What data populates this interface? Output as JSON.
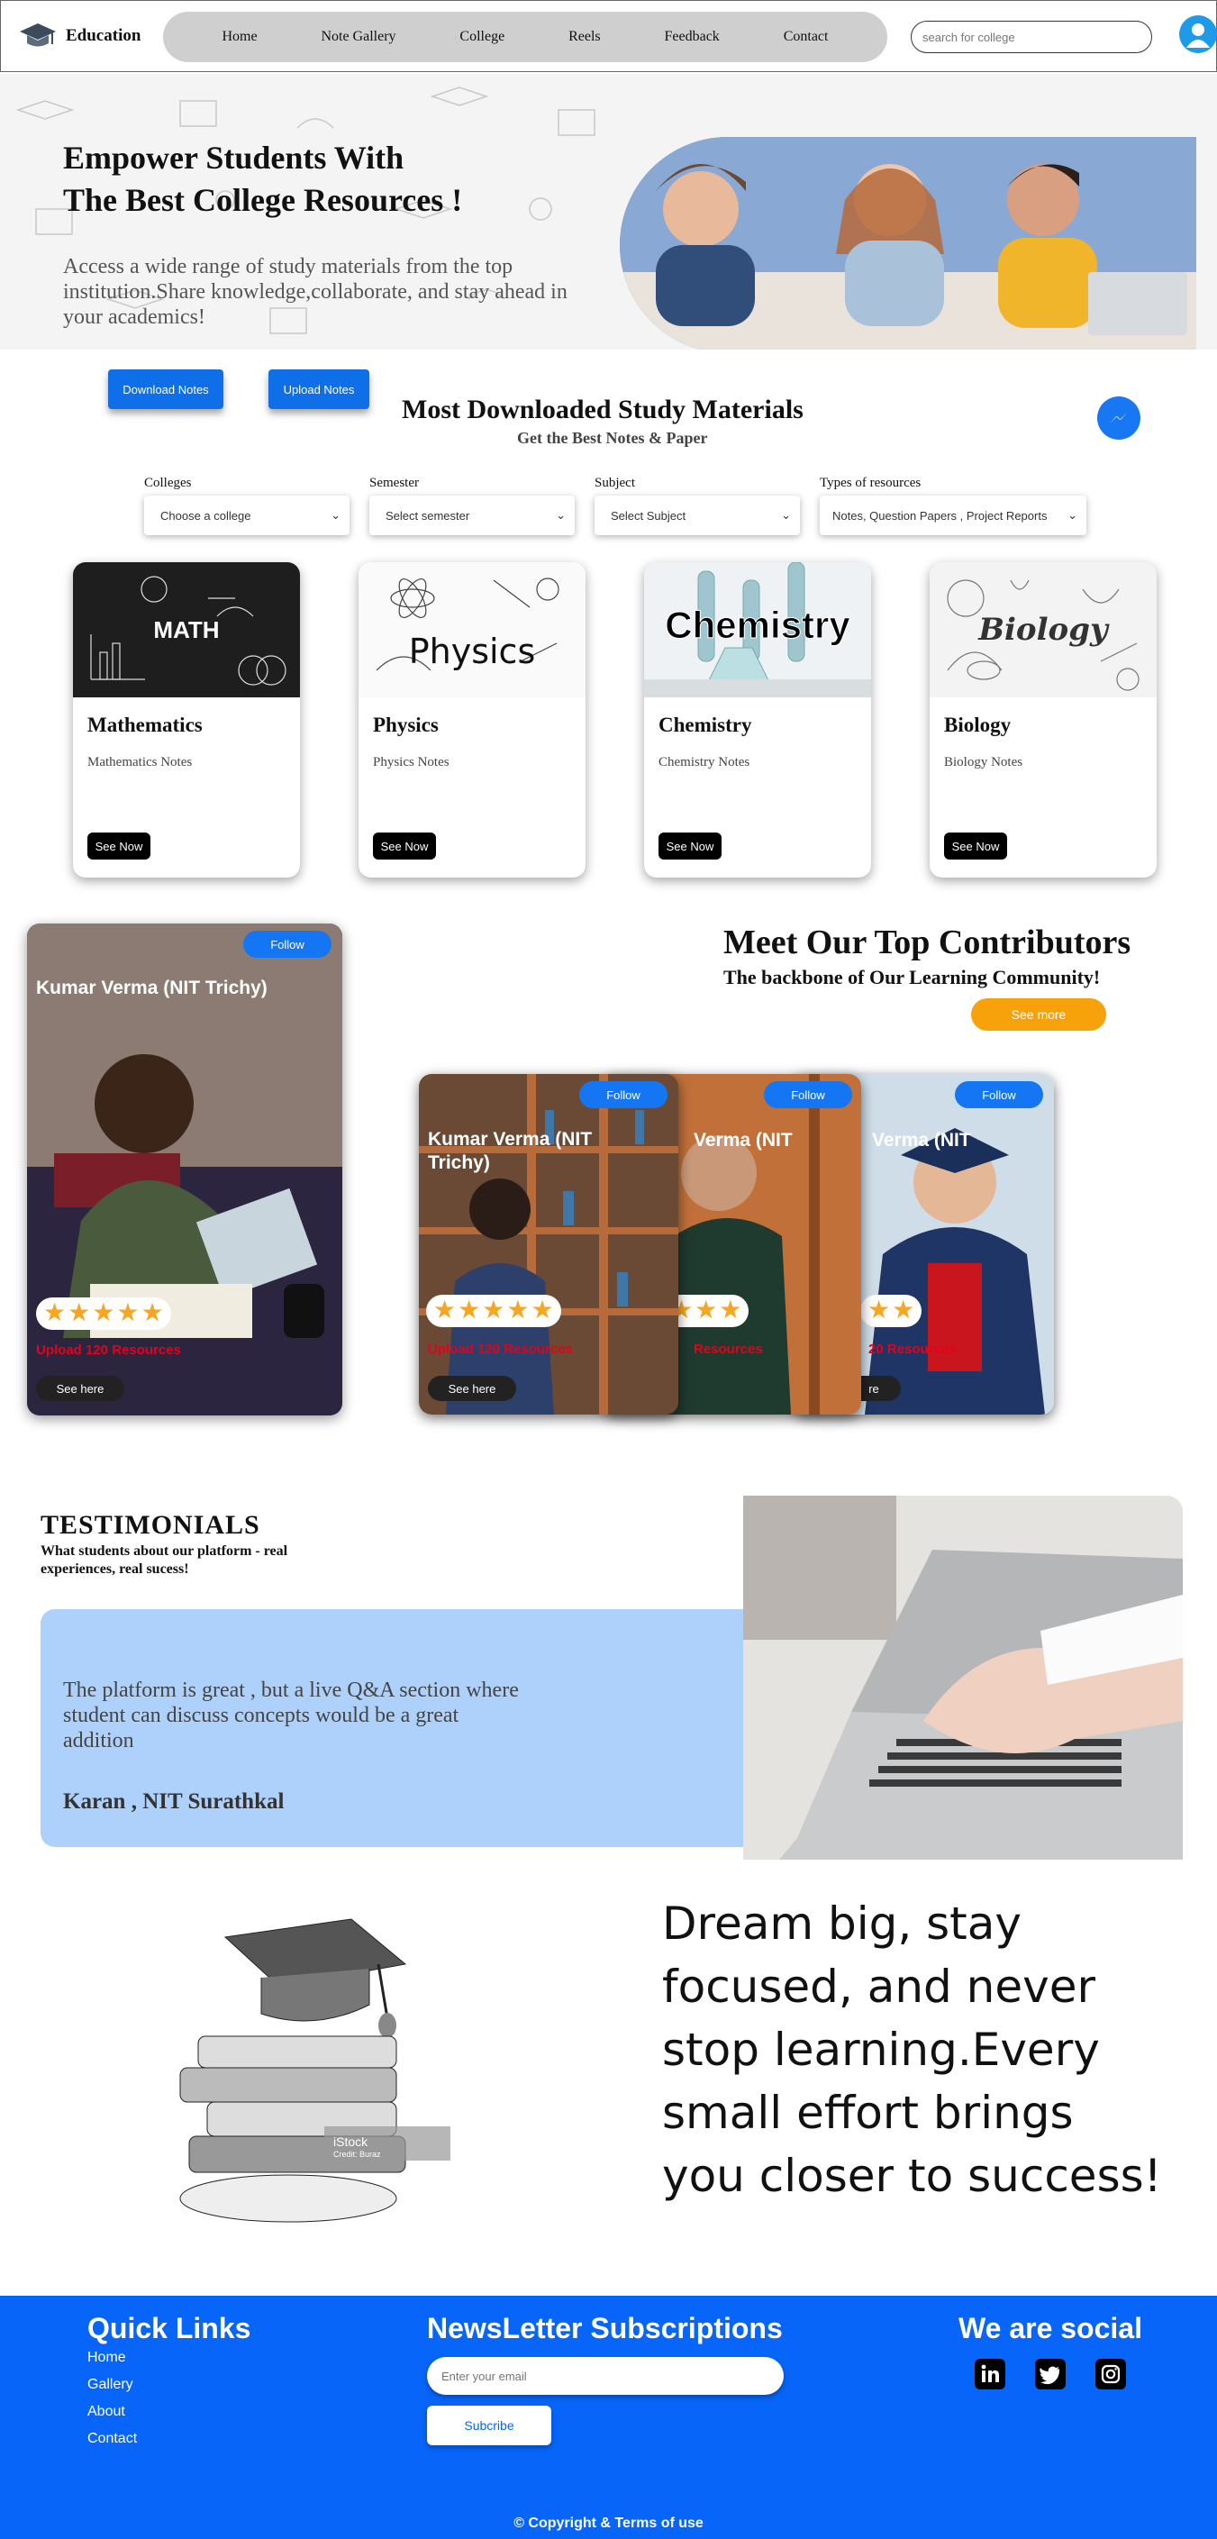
{
  "nav": {
    "brand": "Education",
    "items": [
      "Home",
      "Note Gallery",
      "College",
      "Reels",
      "Feedback",
      "Contact"
    ],
    "search_placeholder": "search for college"
  },
  "hero": {
    "title_line1": "Empower Students With",
    "title_line2": "The Best College Resources !",
    "subtitle": "Access a wide range of study materials from the top institution.Share knowledge,collaborate, and stay ahead in your academics!"
  },
  "actions": {
    "download": "Download Notes",
    "upload": "Upload Notes"
  },
  "materials": {
    "title": "Most Downloaded Study Materials",
    "subtitle": "Get the Best Notes & Paper"
  },
  "filters": [
    {
      "label": "Colleges",
      "value": "Choose a college"
    },
    {
      "label": "Semester",
      "value": "Select semester"
    },
    {
      "label": "Subject",
      "value": "Select Subject"
    },
    {
      "label": "Types of resources",
      "value": "Notes, Question Papers , Project Reports"
    }
  ],
  "cards": [
    {
      "title": "Mathematics",
      "desc": "Mathematics Notes",
      "button": "See Now",
      "image_text": "MATH"
    },
    {
      "title": "Physics",
      "desc": "Physics Notes",
      "button": "See Now",
      "image_text": "Physics"
    },
    {
      "title": "Chemistry",
      "desc": "Chemistry Notes",
      "button": "See Now",
      "image_text": "Chemistry"
    },
    {
      "title": "Biology",
      "desc": "Biology Notes",
      "button": "See Now",
      "image_text": "Biology"
    }
  ],
  "contributors": {
    "title": "Meet Our Top Contributors",
    "subtitle": "The backbone of Our Learning Community!",
    "see_more": "See more",
    "featured": {
      "name": "Kumar Verma (NIT Trichy)",
      "follow": "Follow",
      "uploads": "Upload 120 Resources",
      "see": "See here",
      "rating": 5
    },
    "stack": [
      {
        "name": "Kumar Verma (NIT Trichy)",
        "follow": "Follow",
        "uploads": "Upload 120 Resources",
        "see": "See here",
        "rating": 5
      },
      {
        "name": "Verma (NIT",
        "follow": "Follow",
        "uploads": "Resources",
        "rating": 3
      },
      {
        "name": "Verma (NIT",
        "follow": "Follow",
        "uploads": "20 Resources",
        "see": "re",
        "rating": 2
      }
    ]
  },
  "testimonials": {
    "title": "TESTIMONIALS",
    "subtitle": "What students about our platform - real experiences, real sucess!",
    "quote": "The platform is great , but a live Q&A section where student can discuss concepts would be a great addition",
    "author": "Karan , NIT Surathkal"
  },
  "motto": {
    "text": "Dream big, stay focused, and never stop learning.Every small effort brings you closer to success!",
    "image_watermark": "iStock",
    "image_credit": "Credit: Buraz"
  },
  "footer": {
    "quick_links_title": "Quick Links",
    "links": [
      "Home",
      "Gallery",
      "About",
      "Contact"
    ],
    "newsletter_title": "NewsLetter Subscriptions",
    "email_placeholder": "Enter your email",
    "subscribe": "Subcribe",
    "social_title": "We are social",
    "social_icons": [
      "linkedin-icon",
      "twitter-icon",
      "instagram-icon"
    ],
    "copyright": "© Copyright & Terms of use"
  },
  "colors": {
    "primary": "#0765fa",
    "button_blue": "#0f6fe8",
    "accent_orange": "#f7a20b",
    "testimonial_bg": "#add1fa",
    "nav_pill": "#cfcfcf"
  }
}
